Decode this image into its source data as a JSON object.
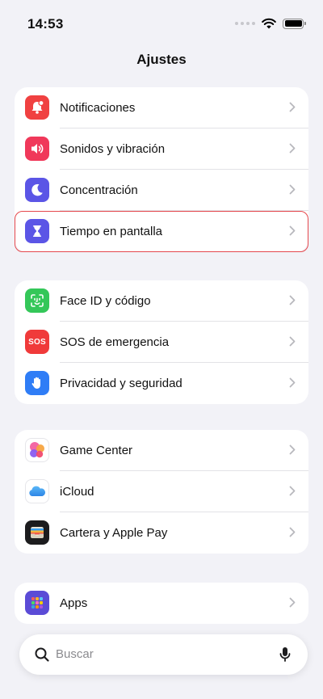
{
  "status_bar": {
    "time": "14:53"
  },
  "header": {
    "title": "Ajustes"
  },
  "groups": [
    {
      "items": [
        {
          "label": "Notificaciones",
          "icon": "bell-badge-icon",
          "color": "#f04141"
        },
        {
          "label": "Sonidos y vibración",
          "icon": "speaker-icon",
          "color": "#f0385a"
        },
        {
          "label": "Concentración",
          "icon": "moon-icon",
          "color": "#5b55e6"
        },
        {
          "label": "Tiempo en pantalla",
          "icon": "hourglass-icon",
          "color": "#5b55e6",
          "highlighted": true
        }
      ]
    },
    {
      "items": [
        {
          "label": "Face ID y código",
          "icon": "face-id-icon",
          "color": "#34c759"
        },
        {
          "label": "SOS de emergencia",
          "icon": "sos-icon",
          "color": "#f03a3a",
          "icon_text": "SOS"
        },
        {
          "label": "Privacidad y seguridad",
          "icon": "hand-icon",
          "color": "#2f7df6"
        }
      ]
    },
    {
      "items": [
        {
          "label": "Game Center",
          "icon": "game-center-icon",
          "color": "#ffffff"
        },
        {
          "label": "iCloud",
          "icon": "cloud-icon",
          "color": "#ffffff"
        },
        {
          "label": "Cartera y Apple Pay",
          "icon": "wallet-icon",
          "color": "#1c1c1e"
        }
      ]
    },
    {
      "items": [
        {
          "label": "Apps",
          "icon": "apps-grid-icon",
          "color": "#5b4bd6"
        }
      ]
    }
  ],
  "search": {
    "placeholder": "Buscar"
  }
}
